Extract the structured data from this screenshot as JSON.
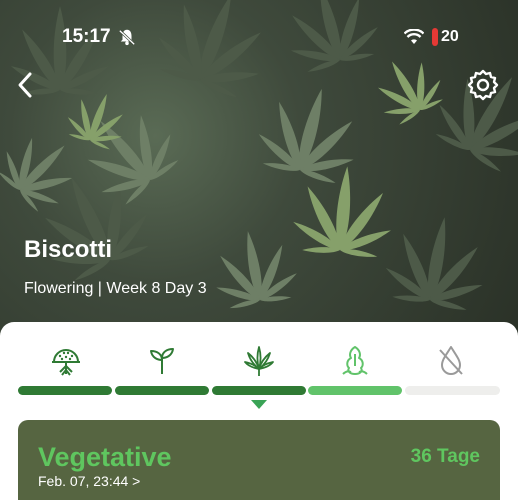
{
  "status_bar": {
    "time": "15:17",
    "battery": "20",
    "icons": [
      "bell-slash-icon",
      "wifi-icon",
      "battery-icon"
    ]
  },
  "nav": {
    "back_icon": "chevron-left-icon",
    "settings_icon": "gear-icon"
  },
  "plant": {
    "name": "Biscotti",
    "subtitle": "Flowering | Week 8 Day 3"
  },
  "stages": [
    {
      "icon": "seed-germination-icon",
      "status": "done"
    },
    {
      "icon": "seedling-icon",
      "status": "done"
    },
    {
      "icon": "cannabis-leaf-icon",
      "status": "done"
    },
    {
      "icon": "flowering-bud-icon",
      "status": "current"
    },
    {
      "icon": "drying-icon",
      "status": "upcoming"
    }
  ],
  "colors": {
    "done": "#2f7a34",
    "current": "#61c36a",
    "upcoming": "#eeeeec",
    "card_bg": "#566541",
    "card_accent": "#5fc65f"
  },
  "current_stage_card": {
    "title": "Vegetative",
    "date": "Feb. 07, 23:44 >",
    "days": "36 Tage"
  }
}
